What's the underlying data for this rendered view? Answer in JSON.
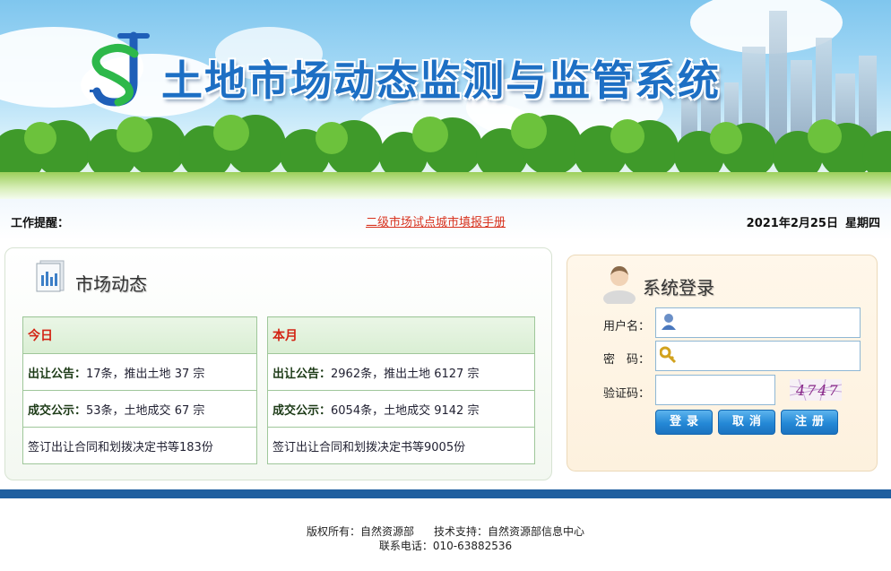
{
  "header": {
    "title": "土地市场动态监测与监管系统",
    "logo_icon": "js-logo-icon"
  },
  "notice": {
    "label": "工作提醒：",
    "link_text": "二级市场试点城市填报手册",
    "date": "2021年2月25日",
    "weekday": "星期四"
  },
  "market": {
    "title": "市场动态",
    "icon": "report-document-icon",
    "today": {
      "header": "今日",
      "rows": [
        {
          "label": "出让公告：",
          "value": "17条，推出土地 37 宗"
        },
        {
          "label": "成交公示：",
          "value": "53条，土地成交 67 宗"
        },
        {
          "label": "",
          "value": "签订出让合同和划拨决定书等183份"
        }
      ]
    },
    "month": {
      "header": "本月",
      "rows": [
        {
          "label": "出让公告：",
          "value": "2962条，推出土地 6127 宗"
        },
        {
          "label": "成交公示：",
          "value": "6054条，土地成交 9142 宗"
        },
        {
          "label": "",
          "value": "签订出让合同和划拨决定书等9005份"
        }
      ]
    }
  },
  "login": {
    "title": "系统登录",
    "username_label": "用户名：",
    "username_value": "",
    "password_label": "密　码：",
    "password_value": "",
    "captcha_label": "验证码：",
    "captcha_value": "",
    "captcha_text": "4747",
    "login_button": "登录",
    "cancel_button": "取消",
    "register_button": "注册"
  },
  "footer": {
    "copyright": "版权所有：自然资源部",
    "support": "技术支持：自然资源部信息中心",
    "phone": "联系电话：010-63882536"
  },
  "colors": {
    "title_blue": "#1d6fc4",
    "notice_red": "#d8331f",
    "button_blue": "#2488d6",
    "footer_rule": "#1f5f9f"
  }
}
